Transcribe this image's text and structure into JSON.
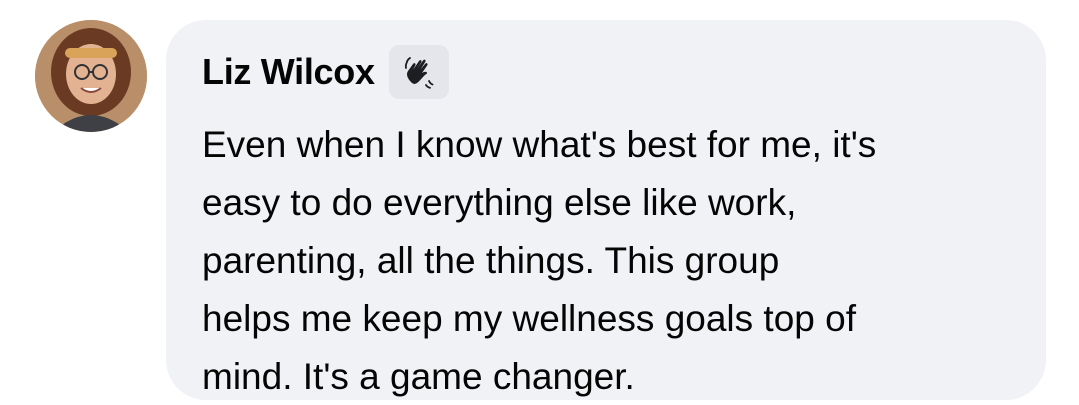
{
  "comment": {
    "author": {
      "name": "Liz Wilcox",
      "badge_icon": "wave-hand-icon"
    },
    "text": "Even when I know what's best for me, it's\neasy to do everything else like work,\nparenting, all the things. This group\nhelps me keep my wellness goals top of\nmind. It's a game changer."
  },
  "colors": {
    "bubble_background": "#f0f2f5",
    "badge_background": "#e4e6eb",
    "text": "#050505"
  }
}
